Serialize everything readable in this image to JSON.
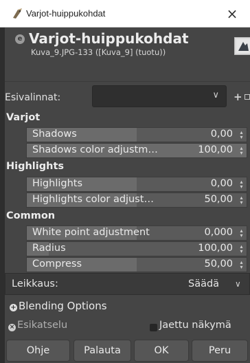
{
  "window": {
    "title": "Varjot-huippukohdat",
    "close_glyph": "×"
  },
  "header": {
    "title": "Varjot-huippukohdat",
    "subtitle": "Kuva_9.JPG-133 ([Kuva_9] (tuotu))",
    "icon": "gegl-icon",
    "thumbnail": "image-thumbnail"
  },
  "presets": {
    "label": "Esivalinnat:",
    "value": "",
    "add_glyph": "+"
  },
  "sections": {
    "shadows": {
      "title": "Varjot"
    },
    "highlights": {
      "title": "Highlights"
    },
    "common": {
      "title": "Common"
    }
  },
  "sliders": {
    "shadows": {
      "label": "Shadows",
      "value": "0,00",
      "fraction": 0.5
    },
    "shadows_color": {
      "label": "Shadows color adjustm…",
      "value": "100,00",
      "fraction": 1.0
    },
    "highlights": {
      "label": "Highlights",
      "value": "0,00",
      "fraction": 0.5
    },
    "highlights_color": {
      "label": "Highlights color adjust…",
      "value": "50,00",
      "fraction": 0.5
    },
    "white_point": {
      "label": "White point adjustment",
      "value": "0,000",
      "fraction": 0.5
    },
    "radius": {
      "label": "Radius",
      "value": "100,00",
      "fraction": 0.1
    },
    "compress": {
      "label": "Compress",
      "value": "50,00",
      "fraction": 0.5
    }
  },
  "clipping": {
    "label": "Leikkaus:",
    "value": "Säädä"
  },
  "blending": {
    "label": "Blending Options"
  },
  "preview": {
    "label": "Esikatselu",
    "split_label": "Jaettu näkymä"
  },
  "buttons": {
    "help": "Ohje",
    "reset": "Palauta",
    "ok": "OK",
    "cancel": "Peru"
  },
  "colors": {
    "bg": "#454545",
    "slider": "#5a5a5a",
    "slider_fill": "#6b6b6b"
  }
}
